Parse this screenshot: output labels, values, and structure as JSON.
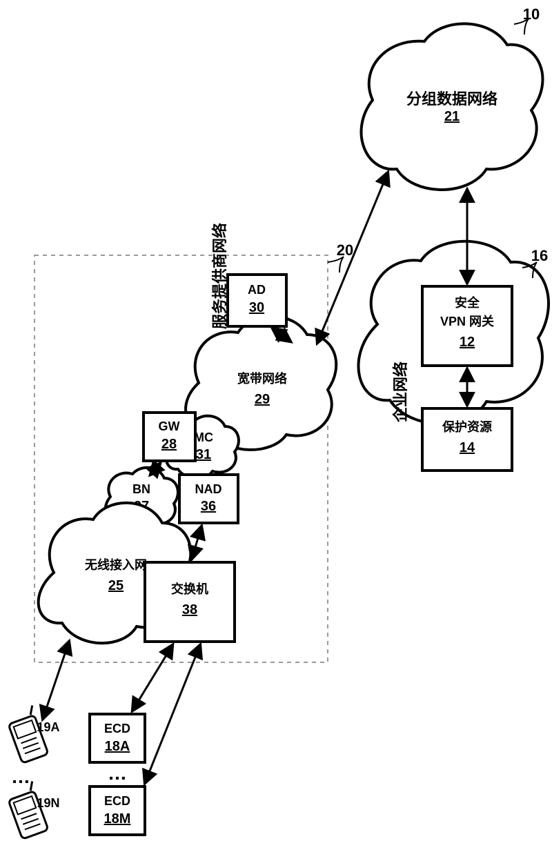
{
  "callouts": {
    "system": "10",
    "sp_network": "20",
    "enterprise": "16"
  },
  "labels": {
    "sp_network": "服务提供商网络",
    "enterprise": "企业网络",
    "packet_data_network": "分组数据网络",
    "packet_data_network_ref": "21",
    "secure_line1": "安全",
    "secure_line2": "VPN 网关",
    "secure_ref": "12",
    "protected_resources": "保护资源",
    "protected_resources_ref": "14",
    "broadband_network": "宽带网络",
    "broadband_network_ref": "29",
    "ad": "AD",
    "ad_ref": "30",
    "mc": "MC",
    "mc_ref": "31",
    "gw": "GW",
    "gw_ref": "28",
    "bn": "BN",
    "bn_ref": "27",
    "nad": "NAD",
    "nad_ref": "36",
    "radio_access_network": "无线接入网",
    "radio_access_network_ref": "25",
    "switch": "交换机",
    "switch_ref": "38",
    "ecd": "ECD",
    "ecd_a_ref": "18A",
    "ecd_m_ref": "18M",
    "dev_a": "19A",
    "dev_n": "19N",
    "dots": "…"
  }
}
